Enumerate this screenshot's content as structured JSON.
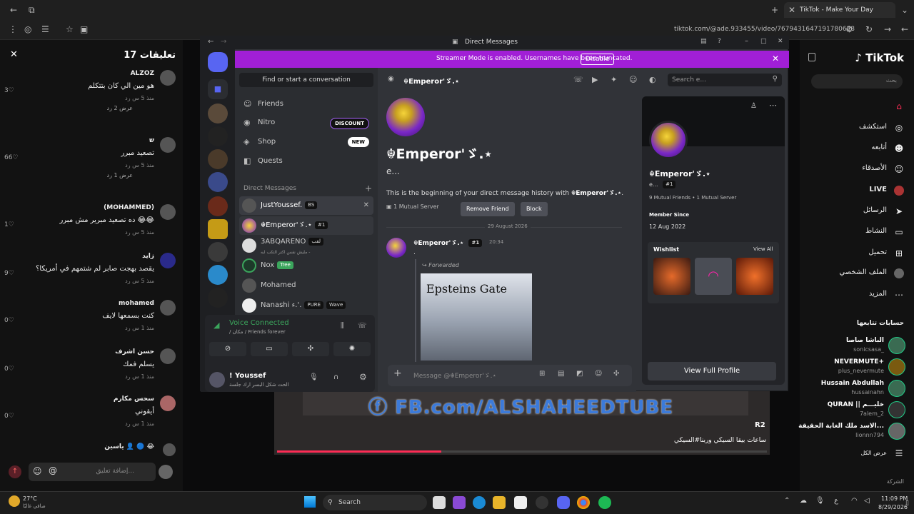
{
  "browser": {
    "tab_title": "TikTok - Make Your Day",
    "url": "tiktok.com/@ade.933455/video/7679431647191780628"
  },
  "comments": {
    "title": "تعليقات 17",
    "input_placeholder": "إضافة تعليق...",
    "items": [
      {
        "name": "ALZOZ",
        "text": "هو مين الي كان بتتكلم",
        "meta": "منذ 5 س   رد",
        "likes": "3",
        "more": "عرض 2 رد"
      },
      {
        "name": "ש",
        "text": "تصعيد مبرر",
        "meta": "منذ 5 س   رد",
        "likes": "66",
        "more": "عرض 1 رد"
      },
      {
        "name": "(MOHAMMED)",
        "text": "ده تصعيد مبرير مش مبرر 😂😂",
        "meta": "منذ 5 س   رد",
        "likes": "1"
      },
      {
        "name": "زايد",
        "text": "يقصد بهجت صابر لم شتمهم في أمريكا؟",
        "meta": "منذ 5 س   رد",
        "likes": "9"
      },
      {
        "name": "mohamed",
        "text": "كنت بسمعها لايف",
        "meta": "منذ 1 س   رد",
        "likes": "0"
      },
      {
        "name": "حسن اشرف",
        "text": "يسلم فمك",
        "meta": "منذ 1 س   رد",
        "likes": "0"
      },
      {
        "name": "سحس مكارم",
        "text": "أيقوني",
        "meta": "منذ 1 س   رد",
        "likes": "0"
      },
      {
        "name": "ياسين 👤 🔵 😂",
        "text": "",
        "meta": "",
        "likes": ""
      }
    ]
  },
  "video": {
    "overlay_text": "FB.com/ALSHAHEEDTUBE",
    "tag": "R2",
    "caption": "ساعات بيقا السيكي وربنا#السيكي"
  },
  "tiktok_nav": {
    "logo": "TikTok",
    "search_placeholder": "بحث",
    "items": [
      "استكشف",
      "أتابعه",
      "الأصدقاء",
      "LIVE",
      "الرسائل",
      "النشاط",
      "تحميل",
      "الملف الشخصي",
      "المزيد"
    ],
    "following_title": "حسابات تتابعها",
    "following": [
      {
        "name": "الباشا صاصا",
        "user": "sonicsasa_"
      },
      {
        "name": "NEVERMUTE+",
        "user": "plus_nevermute"
      },
      {
        "name": "Hussain Abdullah",
        "user": "hussainahn"
      },
      {
        "name": "QURAN || خليـــم",
        "user": "7alem_2"
      },
      {
        "name": "الاسد ملك الغابة الحقيقة...",
        "user": "lionnn794"
      }
    ],
    "see_all": "عرض الكل",
    "company": "الشركة"
  },
  "discord": {
    "window_title": "Direct Messages",
    "banner": {
      "text": "Streamer Mode is enabled. Usernames have been truncated.",
      "button": "Disable"
    },
    "search": "Find or start a conversation",
    "nav": [
      {
        "label": "Friends",
        "icon": "friends-icon"
      },
      {
        "label": "Nitro",
        "icon": "nitro-icon",
        "badge": "DISCOUNT"
      },
      {
        "label": "Shop",
        "icon": "shop-icon",
        "badge": "NEW"
      },
      {
        "label": "Quests",
        "icon": "quests-icon"
      }
    ],
    "dm_header": "Direct Messages",
    "dms": [
      {
        "name": "JustYoussef.",
        "tag": "BS"
      },
      {
        "name": "☬Emperor'ゞ.⋆",
        "tag": "#1"
      },
      {
        "name": "3ABQARENO",
        "tag": "لقب",
        "sub": "مليش نفس اكتر التكب ايه -"
      },
      {
        "name": "Nox",
        "tag": "Tree"
      },
      {
        "name": "Mohamed",
        "tag": ""
      },
      {
        "name": "Nanashi ء.'.",
        "tag": "PURE",
        "extra": "Wave"
      }
    ],
    "voice": {
      "title": "Voice Connected",
      "sub": "/ مكان / Friends forever"
    },
    "user": {
      "name": "! Youssef",
      "status": "الحت شكل البسر ارك جلسة"
    },
    "chat": {
      "recipient": "☬Emperor'ゞ.⋆",
      "handle": "e...",
      "search_placeholder": "Search e...",
      "beginning_prefix": "This is the beginning of your direct message history with ",
      "beginning_name": "☬Emperor'ゞ.⋆",
      "beginning_suffix": ".",
      "mutual_servers": "1 Mutual Server",
      "remove_friend": "Remove Friend",
      "block": "Block",
      "date_sep": "29 August 2026",
      "message": {
        "author": "☬Emperor'ゞ.⋆",
        "tag": "#1",
        "time": "20:34",
        "dot": ".",
        "forwarded": "Forwarded",
        "image_title": "Epsteins Gate"
      },
      "composer_placeholder": "Message @☬Emperor'ゞ.⋆"
    },
    "profile": {
      "name": "☬Emperor'ゞ.⋆",
      "handle": "e...",
      "tag": "#1",
      "mutual": "9 Mutual Friends • 1 Mutual Server",
      "member_since_label": "Member Since",
      "member_since": "12 Aug 2022",
      "wishlist_label": "Wishlist",
      "view_all": "View All",
      "view_full": "View Full Profile"
    }
  },
  "taskbar": {
    "weather_temp": "27°C",
    "weather_desc": "صافي غالبًا",
    "search": "Search",
    "time": "11:09 PM",
    "date": "8/29/2026"
  }
}
